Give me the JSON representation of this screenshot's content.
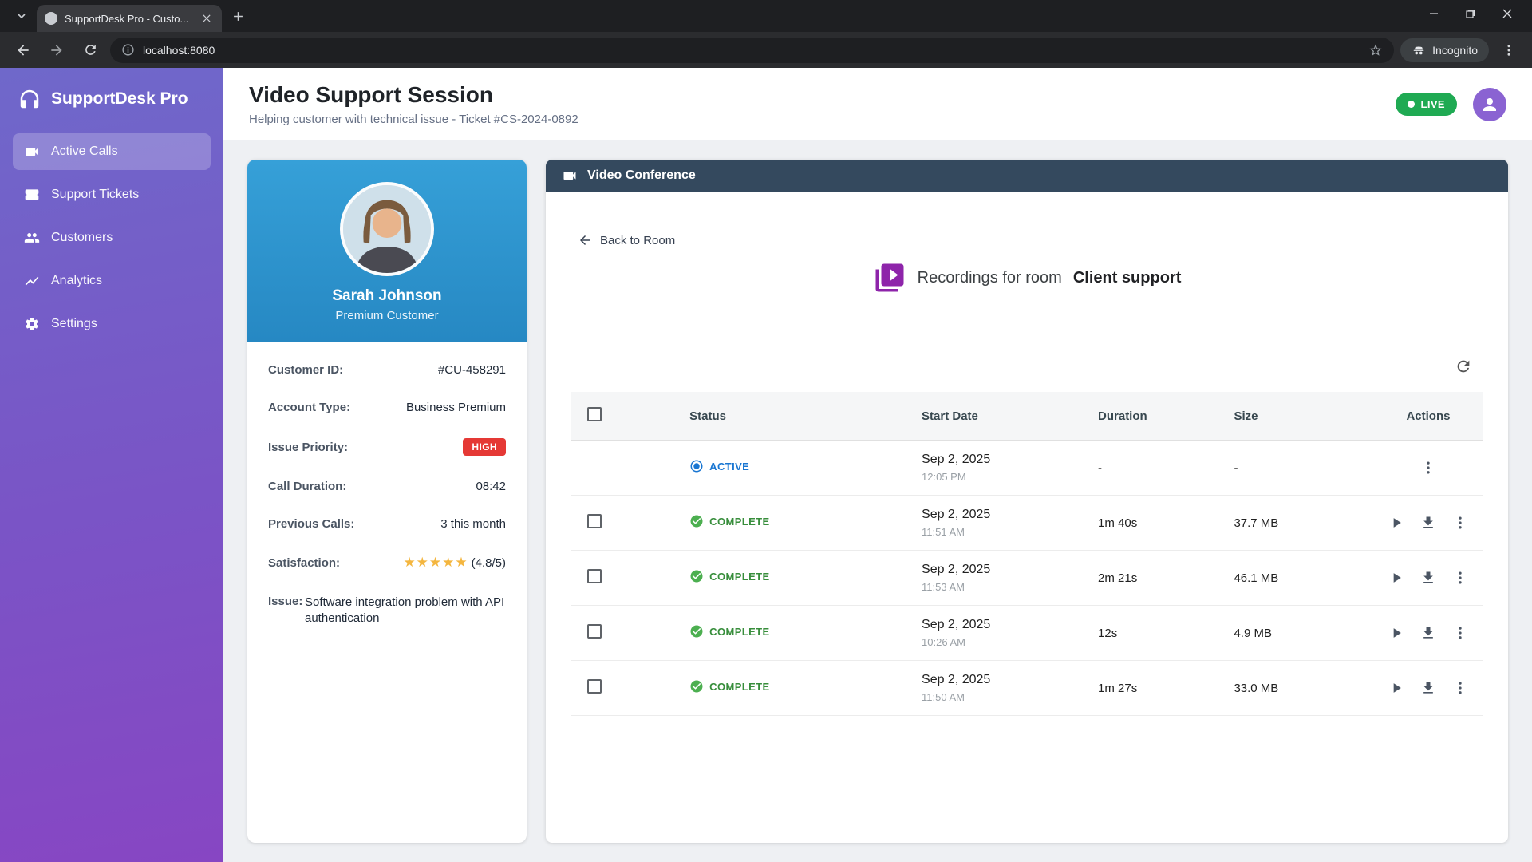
{
  "browser": {
    "tab_title": "SupportDesk Pro - Custo...",
    "url": "localhost:8080",
    "incognito_label": "Incognito"
  },
  "sidebar": {
    "brand": "SupportDesk Pro",
    "items": [
      {
        "label": "Active Calls",
        "active": true
      },
      {
        "label": "Support Tickets",
        "active": false
      },
      {
        "label": "Customers",
        "active": false
      },
      {
        "label": "Analytics",
        "active": false
      },
      {
        "label": "Settings",
        "active": false
      }
    ]
  },
  "header": {
    "title": "Video Support Session",
    "subtitle": "Helping customer with technical issue - Ticket #CS-2024-0892",
    "live_label": "LIVE"
  },
  "customer": {
    "name": "Sarah Johnson",
    "type": "Premium Customer",
    "customer_id_label": "Customer ID:",
    "customer_id": "#CU-458291",
    "account_type_label": "Account Type:",
    "account_type": "Business Premium",
    "issue_priority_label": "Issue Priority:",
    "issue_priority": "HIGH",
    "call_duration_label": "Call Duration:",
    "call_duration": "08:42",
    "previous_calls_label": "Previous Calls:",
    "previous_calls": "3 this month",
    "satisfaction_label": "Satisfaction:",
    "satisfaction_stars": "★★★★★",
    "satisfaction_value": "(4.8/5)",
    "issue_label": "Issue:",
    "issue": "Software integration problem with API authentication"
  },
  "conference": {
    "title": "Video Conference",
    "back_label": "Back to Room",
    "recordings_label": "Recordings for room",
    "room_name": "Client support",
    "table": {
      "headers": {
        "status": "Status",
        "start_date": "Start Date",
        "duration": "Duration",
        "size": "Size",
        "actions": "Actions"
      },
      "rows": [
        {
          "status": "ACTIVE",
          "state": "active",
          "date": "Sep 2, 2025",
          "time": "12:05 PM",
          "duration": "-",
          "size": "-",
          "selectable": false,
          "playable": false
        },
        {
          "status": "COMPLETE",
          "state": "complete",
          "date": "Sep 2, 2025",
          "time": "11:51 AM",
          "duration": "1m 40s",
          "size": "37.7 MB",
          "selectable": true,
          "playable": true
        },
        {
          "status": "COMPLETE",
          "state": "complete",
          "date": "Sep 2, 2025",
          "time": "11:53 AM",
          "duration": "2m 21s",
          "size": "46.1 MB",
          "selectable": true,
          "playable": true
        },
        {
          "status": "COMPLETE",
          "state": "complete",
          "date": "Sep 2, 2025",
          "time": "10:26 AM",
          "duration": "12s",
          "size": "4.9 MB",
          "selectable": true,
          "playable": true
        },
        {
          "status": "COMPLETE",
          "state": "complete",
          "date": "Sep 2, 2025",
          "time": "11:50 AM",
          "duration": "1m 27s",
          "size": "33.0 MB",
          "selectable": true,
          "playable": true
        }
      ]
    }
  },
  "icons": {
    "brand": "headset",
    "active_calls": "videocam",
    "support_tickets": "ticket",
    "customers": "people",
    "analytics": "line-chart",
    "settings": "gear",
    "conference": "videocam",
    "back": "arrow-left",
    "recordings": "video-library",
    "refresh": "refresh",
    "active_status": "record-dot",
    "complete_status": "check-circle",
    "play": "play-triangle",
    "download": "download-arrow",
    "more": "kebab-menu"
  },
  "colors": {
    "sidebar_gradient_start": "#6f68ca",
    "sidebar_gradient_end": "#8746c3",
    "live_green": "#1faa53",
    "priority_red": "#e53935",
    "active_blue": "#1976d2",
    "complete_green": "#43a047",
    "customer_header_blue": "#2e96d0",
    "conference_header_slate": "#34495e",
    "recordings_icon_purple": "#8e24aa"
  }
}
